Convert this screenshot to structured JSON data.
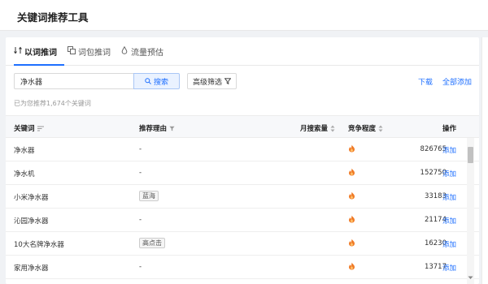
{
  "header": {
    "title": "关键词推荐工具"
  },
  "tabs": [
    {
      "label": "以词推词",
      "icon": "keyword-swap-icon",
      "active": true
    },
    {
      "label": "词包推词",
      "icon": "copy-icon",
      "active": false
    },
    {
      "label": "流量预估",
      "icon": "drop-icon",
      "active": false
    }
  ],
  "search": {
    "value": "净水器",
    "button_label": "搜索",
    "button_icon": "search-icon"
  },
  "filter": {
    "label": "高级筛选",
    "icon": "filter-icon"
  },
  "actions": {
    "download": "下载",
    "add_all": "全部添加"
  },
  "summary": "已为您推荐1,674个关键词",
  "table": {
    "columns": [
      {
        "label": "关键词",
        "icon": "sort-lines-icon"
      },
      {
        "label": "推荐理由",
        "icon": "filter-icon"
      },
      {
        "label": "月搜索量",
        "icon": "sort-icon"
      },
      {
        "label": "竞争程度",
        "icon": "sort-icon"
      },
      {
        "label": "操作"
      }
    ],
    "rows": [
      {
        "keyword": "净水器",
        "reason": "-",
        "reason_is_tag": false,
        "volume": "826765",
        "action": "添加"
      },
      {
        "keyword": "净水机",
        "reason": "-",
        "reason_is_tag": false,
        "volume": "152750",
        "action": "添加"
      },
      {
        "keyword": "小米净水器",
        "reason": "蓝海",
        "reason_is_tag": true,
        "volume": "33183",
        "action": "添加"
      },
      {
        "keyword": "沁园净水器",
        "reason": "-",
        "reason_is_tag": false,
        "volume": "21174",
        "action": "添加"
      },
      {
        "keyword": "10大名牌净水器",
        "reason": "高点击",
        "reason_is_tag": true,
        "volume": "16230",
        "action": "添加"
      },
      {
        "keyword": "家用净水器",
        "reason": "-",
        "reason_is_tag": false,
        "volume": "13717",
        "action": "添加"
      }
    ]
  },
  "colors": {
    "accent": "#1e6fff",
    "fire": "#f07c28"
  }
}
